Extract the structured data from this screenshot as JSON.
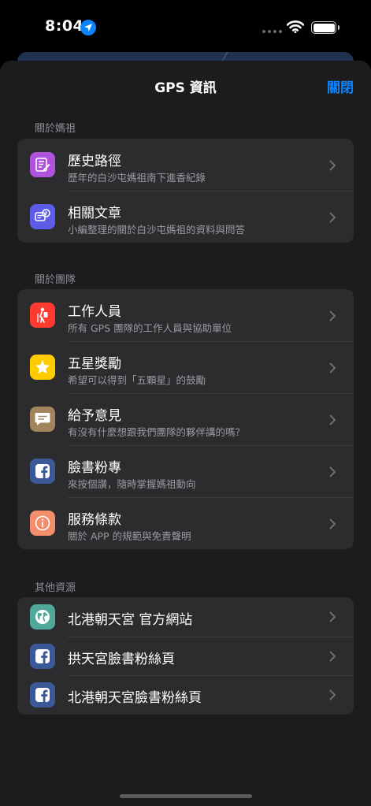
{
  "status_bar": {
    "time": "8:04"
  },
  "sheet": {
    "title": "GPS 資訊",
    "close_label": "關閉"
  },
  "sections": [
    {
      "header": "關於媽祖",
      "items": [
        {
          "title": "歷史路徑",
          "subtitle": "歷年的白沙屯媽祖南下進香紀錄",
          "icon": "document-pen-icon",
          "color": "#af52de"
        },
        {
          "title": "相關文章",
          "subtitle": "小編整理的關於白沙屯媽祖的資料與問答",
          "icon": "chat-question-icon",
          "color": "#5e5ce6"
        }
      ]
    },
    {
      "header": "關於團隊",
      "items": [
        {
          "title": "工作人員",
          "subtitle": "所有 GPS 團隊的工作人員與協助單位",
          "icon": "hiker-icon",
          "color": "#ff3b30"
        },
        {
          "title": "五星獎勵",
          "subtitle": "希望可以得到「五顆星」的鼓勵",
          "icon": "star-icon",
          "color": "#ffcc00"
        },
        {
          "title": "給予意見",
          "subtitle": "有沒有什麼想跟我們團隊的夥伴講的嗎？",
          "icon": "message-icon",
          "color": "#a2845e"
        },
        {
          "title": "臉書粉專",
          "subtitle": "來按個讚，隨時掌握媽祖動向",
          "icon": "facebook-icon",
          "color": "#3b5998"
        },
        {
          "title": "服務條款",
          "subtitle": "關於 APP 的規範與免責聲明",
          "icon": "info-icon",
          "color": "#f28e6b"
        }
      ]
    },
    {
      "header": "其他資源",
      "items": [
        {
          "title": "北港朝天宮 官方網站",
          "icon": "globe-icon",
          "color": "#4fa89a"
        },
        {
          "title": "拱天宮臉書粉絲頁",
          "icon": "facebook-icon",
          "color": "#3b5998"
        },
        {
          "title": "北港朝天宮臉書粉絲頁",
          "icon": "facebook-icon",
          "color": "#3b5998"
        }
      ]
    }
  ]
}
